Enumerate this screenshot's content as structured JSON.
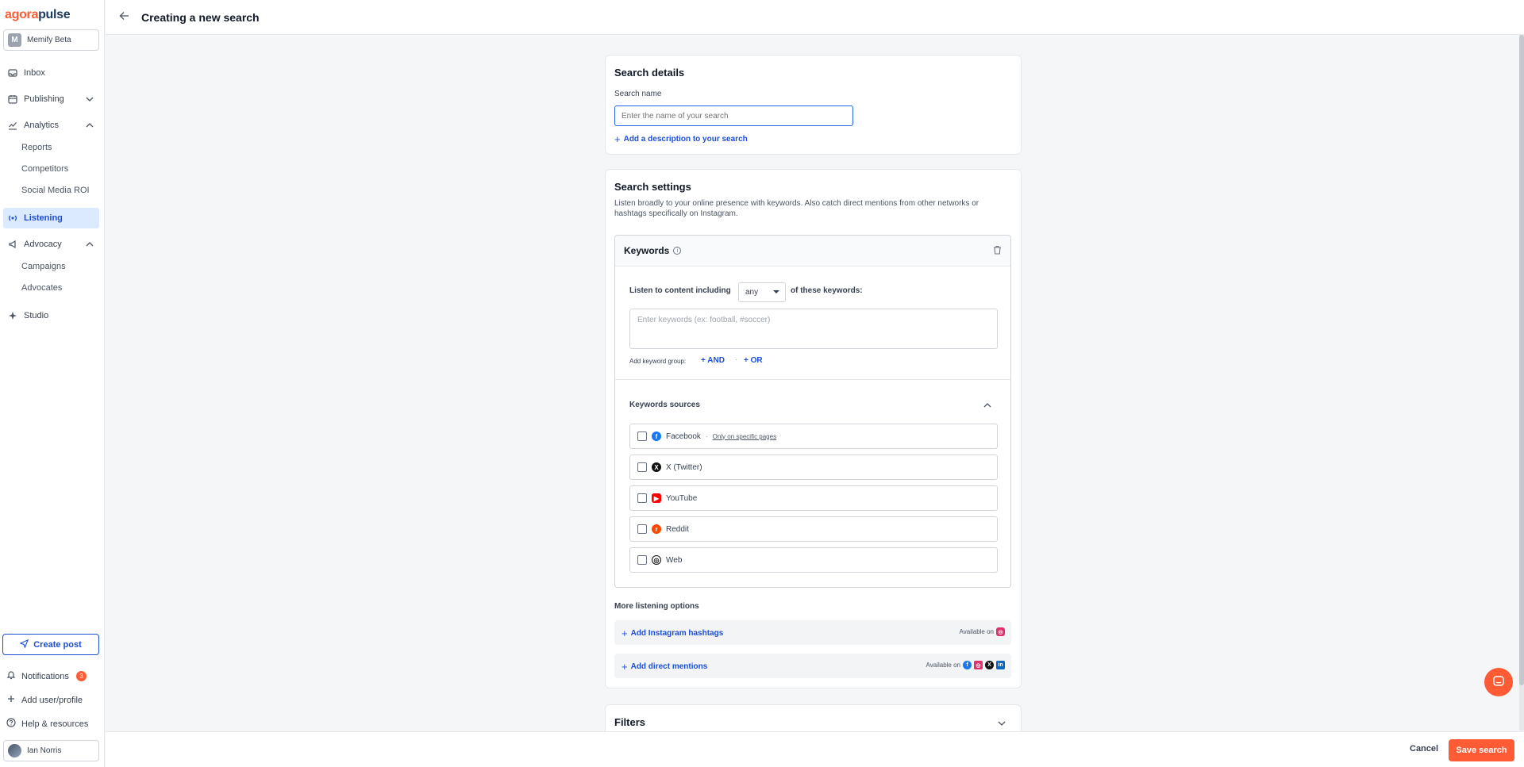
{
  "brand": {
    "logo_part1": "agora",
    "logo_part2": "pulse",
    "accent": "#ff5c35"
  },
  "sidebar": {
    "workspace": {
      "initial": "M",
      "name": "Memify Beta"
    },
    "items": [
      {
        "label": "Inbox",
        "icon": "inbox-icon"
      },
      {
        "label": "Publishing",
        "icon": "calendar-icon"
      },
      {
        "label": "Analytics",
        "icon": "chart-icon"
      },
      {
        "label": "Listening",
        "icon": "listening-icon"
      },
      {
        "label": "Advocacy",
        "icon": "megaphone-icon"
      },
      {
        "label": "Studio",
        "icon": "sparkle-icon"
      }
    ],
    "analytics_sub": [
      "Reports",
      "Competitors",
      "Social Media ROI"
    ],
    "advocacy_sub": [
      "Campaigns",
      "Advocates"
    ],
    "create_post": "Create post",
    "notifications": {
      "label": "Notifications",
      "count": "3"
    },
    "add_user": "Add user/profile",
    "help": "Help & resources",
    "user": "Ian Norris"
  },
  "header": {
    "title": "Creating a new search"
  },
  "search_details": {
    "title": "Search details",
    "name_label": "Search name",
    "name_placeholder": "Enter the name of your search",
    "add_description": "Add a description to your search"
  },
  "search_settings": {
    "title": "Search settings",
    "description": "Listen broadly to your online presence with keywords. Also catch direct mentions from other networks or hashtags specifically on Instagram.",
    "keywords": {
      "title": "Keywords",
      "listen_label": "Listen to content including",
      "match_select": "any",
      "of_label": "of these keywords:",
      "input_placeholder": "Enter keywords (ex: football, #soccer)",
      "group_label": "Add keyword group:",
      "and": "AND",
      "or": "OR",
      "sources_title": "Keywords sources",
      "sources": [
        {
          "label": "Facebook",
          "note": "Only on specific pages",
          "color": "#1877f2"
        },
        {
          "label": "X (Twitter)",
          "color": "#111111"
        },
        {
          "label": "YouTube",
          "color": "#ff0000"
        },
        {
          "label": "Reddit",
          "color": "#ff4500"
        },
        {
          "label": "Web",
          "color": "#111111"
        }
      ]
    },
    "more_title": "More listening options",
    "instagram_hashtags": {
      "label": "Add Instagram hashtags",
      "available": "Available on"
    },
    "direct_mentions": {
      "label": "Add direct mentions",
      "available": "Available on"
    }
  },
  "filters": {
    "title": "Filters"
  },
  "footer": {
    "cancel": "Cancel",
    "save": "Save search"
  }
}
